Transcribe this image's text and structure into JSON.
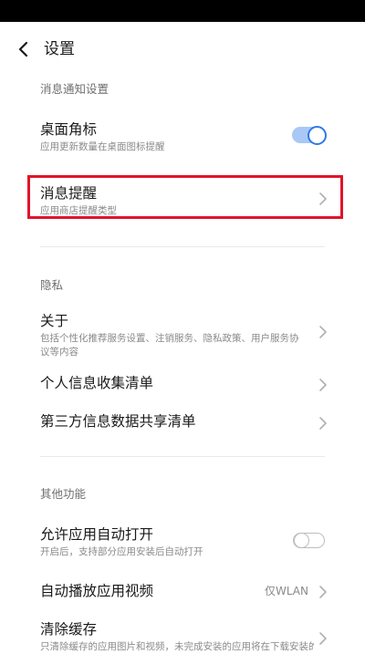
{
  "header": {
    "title": "设置"
  },
  "sections": {
    "notifications": {
      "title": "消息通知设置",
      "badge": {
        "title": "桌面角标",
        "subtitle": "应用更新数量在桌面图标提醒",
        "enabled": true
      },
      "reminder": {
        "title": "消息提醒",
        "subtitle": "应用商店提醒类型"
      }
    },
    "privacy": {
      "title": "隐私",
      "about": {
        "title": "关于",
        "subtitle": "包括个性化推荐服务设置、注销服务、隐私政策、用户服务协议等内容"
      },
      "personal_info": {
        "title": "个人信息收集清单"
      },
      "third_party": {
        "title": "第三方信息数据共享清单"
      }
    },
    "other": {
      "title": "其他功能",
      "auto_open": {
        "title": "允许应用自动打开",
        "subtitle": "开启后，支持部分应用安装后自动打开",
        "enabled": false
      },
      "autoplay": {
        "title": "自动播放应用视频",
        "value": "仅WLAN"
      },
      "clear_cache": {
        "title": "清除缓存",
        "subtitle": "只清除缓存的应用图片和视频，未完成安装的应用将在下载安装的"
      }
    }
  },
  "colors": {
    "accent": "#2f79e8",
    "highlight": "#e0142b"
  }
}
